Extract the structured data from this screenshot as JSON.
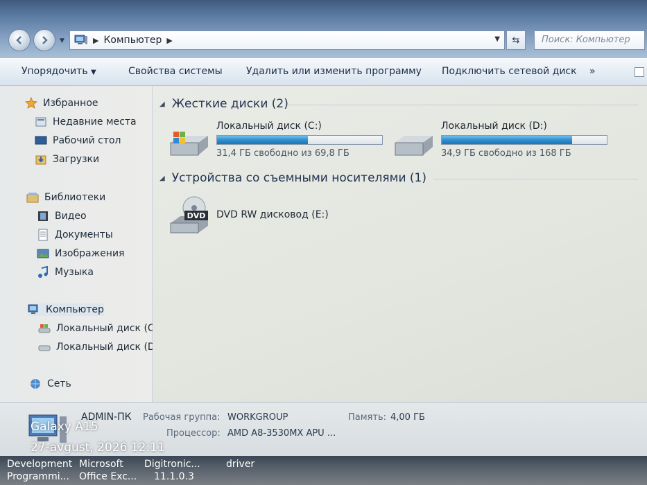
{
  "window": {
    "address_path": "Компьютер",
    "search_placeholder": "Поиск: Компьютер"
  },
  "toolbar": {
    "organize": "Упорядочить",
    "system_properties": "Свойства системы",
    "uninstall": "Удалить или изменить программу",
    "map_drive": "Подключить сетевой диск",
    "more": "»"
  },
  "sidebar": {
    "favorites": "Избранное",
    "recent": "Недавние места",
    "desktop": "Рабочий стол",
    "downloads": "Загрузки",
    "libraries": "Библиотеки",
    "video": "Видео",
    "documents": "Документы",
    "images": "Изображения",
    "music": "Музыка",
    "computer": "Компьютер",
    "disk_c": "Локальный диск (C",
    "disk_d": "Локальный диск (D",
    "network": "Сеть"
  },
  "content": {
    "hard_disks_header": "Жесткие диски (2)",
    "drives": [
      {
        "name": "Локальный диск (C:)",
        "free": "31,4 ГБ свободно из 69,8 ГБ",
        "used_fraction": 0.55
      },
      {
        "name": "Локальный диск (D:)",
        "free": "34,9 ГБ свободно из 168 ГБ",
        "used_fraction": 0.79
      }
    ],
    "removable_header": "Устройства со съемными носителями (1)",
    "dvd": {
      "name": "DVD RW дисковод (E:)",
      "icon_text": "DVD"
    }
  },
  "details": {
    "computer_name": "ADMIN-ПК",
    "workgroup_label": "Рабочая группа:",
    "workgroup_value": "WORKGROUP",
    "memory_label": "Память:",
    "memory_value": "4,00 ГБ",
    "processor_label": "Процессор:",
    "processor_value": "AMD A8-3530MX APU ..."
  },
  "overlay": {
    "device": "Galaxy A15",
    "timestamp": "27-avgust, 2026 12:11"
  },
  "taskbar": {
    "items": [
      {
        "line1": "Development",
        "line2": "Programmi..."
      },
      {
        "line1": "Microsoft",
        "line2": "Office Exc..."
      },
      {
        "line1": "Digitronic...",
        "line2": "11.1.0.3"
      },
      {
        "line1": "driver",
        "line2": ""
      }
    ]
  },
  "colors": {
    "accent_bar": "#2f8fd0",
    "toolbar_text": "#1e2e45",
    "group_header": "#22354f"
  }
}
